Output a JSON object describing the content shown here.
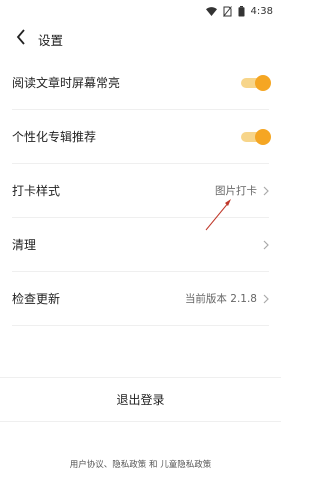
{
  "status_bar": {
    "time": "4:38",
    "icons": [
      "wifi-icon",
      "no-sim-icon",
      "battery-icon"
    ]
  },
  "header": {
    "title": "设置",
    "back_icon": "chevron-left-icon"
  },
  "settings": {
    "rows": [
      {
        "label": "阅读文章时屏幕常亮",
        "type": "toggle",
        "on": true
      },
      {
        "label": "个性化专辑推荐",
        "type": "toggle",
        "on": true
      },
      {
        "label": "打卡样式",
        "type": "link",
        "value": "图片打卡"
      },
      {
        "label": "清理",
        "type": "link",
        "value": ""
      },
      {
        "label": "检查更新",
        "type": "link",
        "value": "当前版本 2.1.8"
      }
    ]
  },
  "logout_label": "退出登录",
  "footer": {
    "text": "用户协议、隐私政策 和 儿童隐私政策"
  },
  "colors": {
    "accent": "#f5a623",
    "accent_light": "#f7d58a",
    "annotation_arrow": "#c0392b"
  }
}
